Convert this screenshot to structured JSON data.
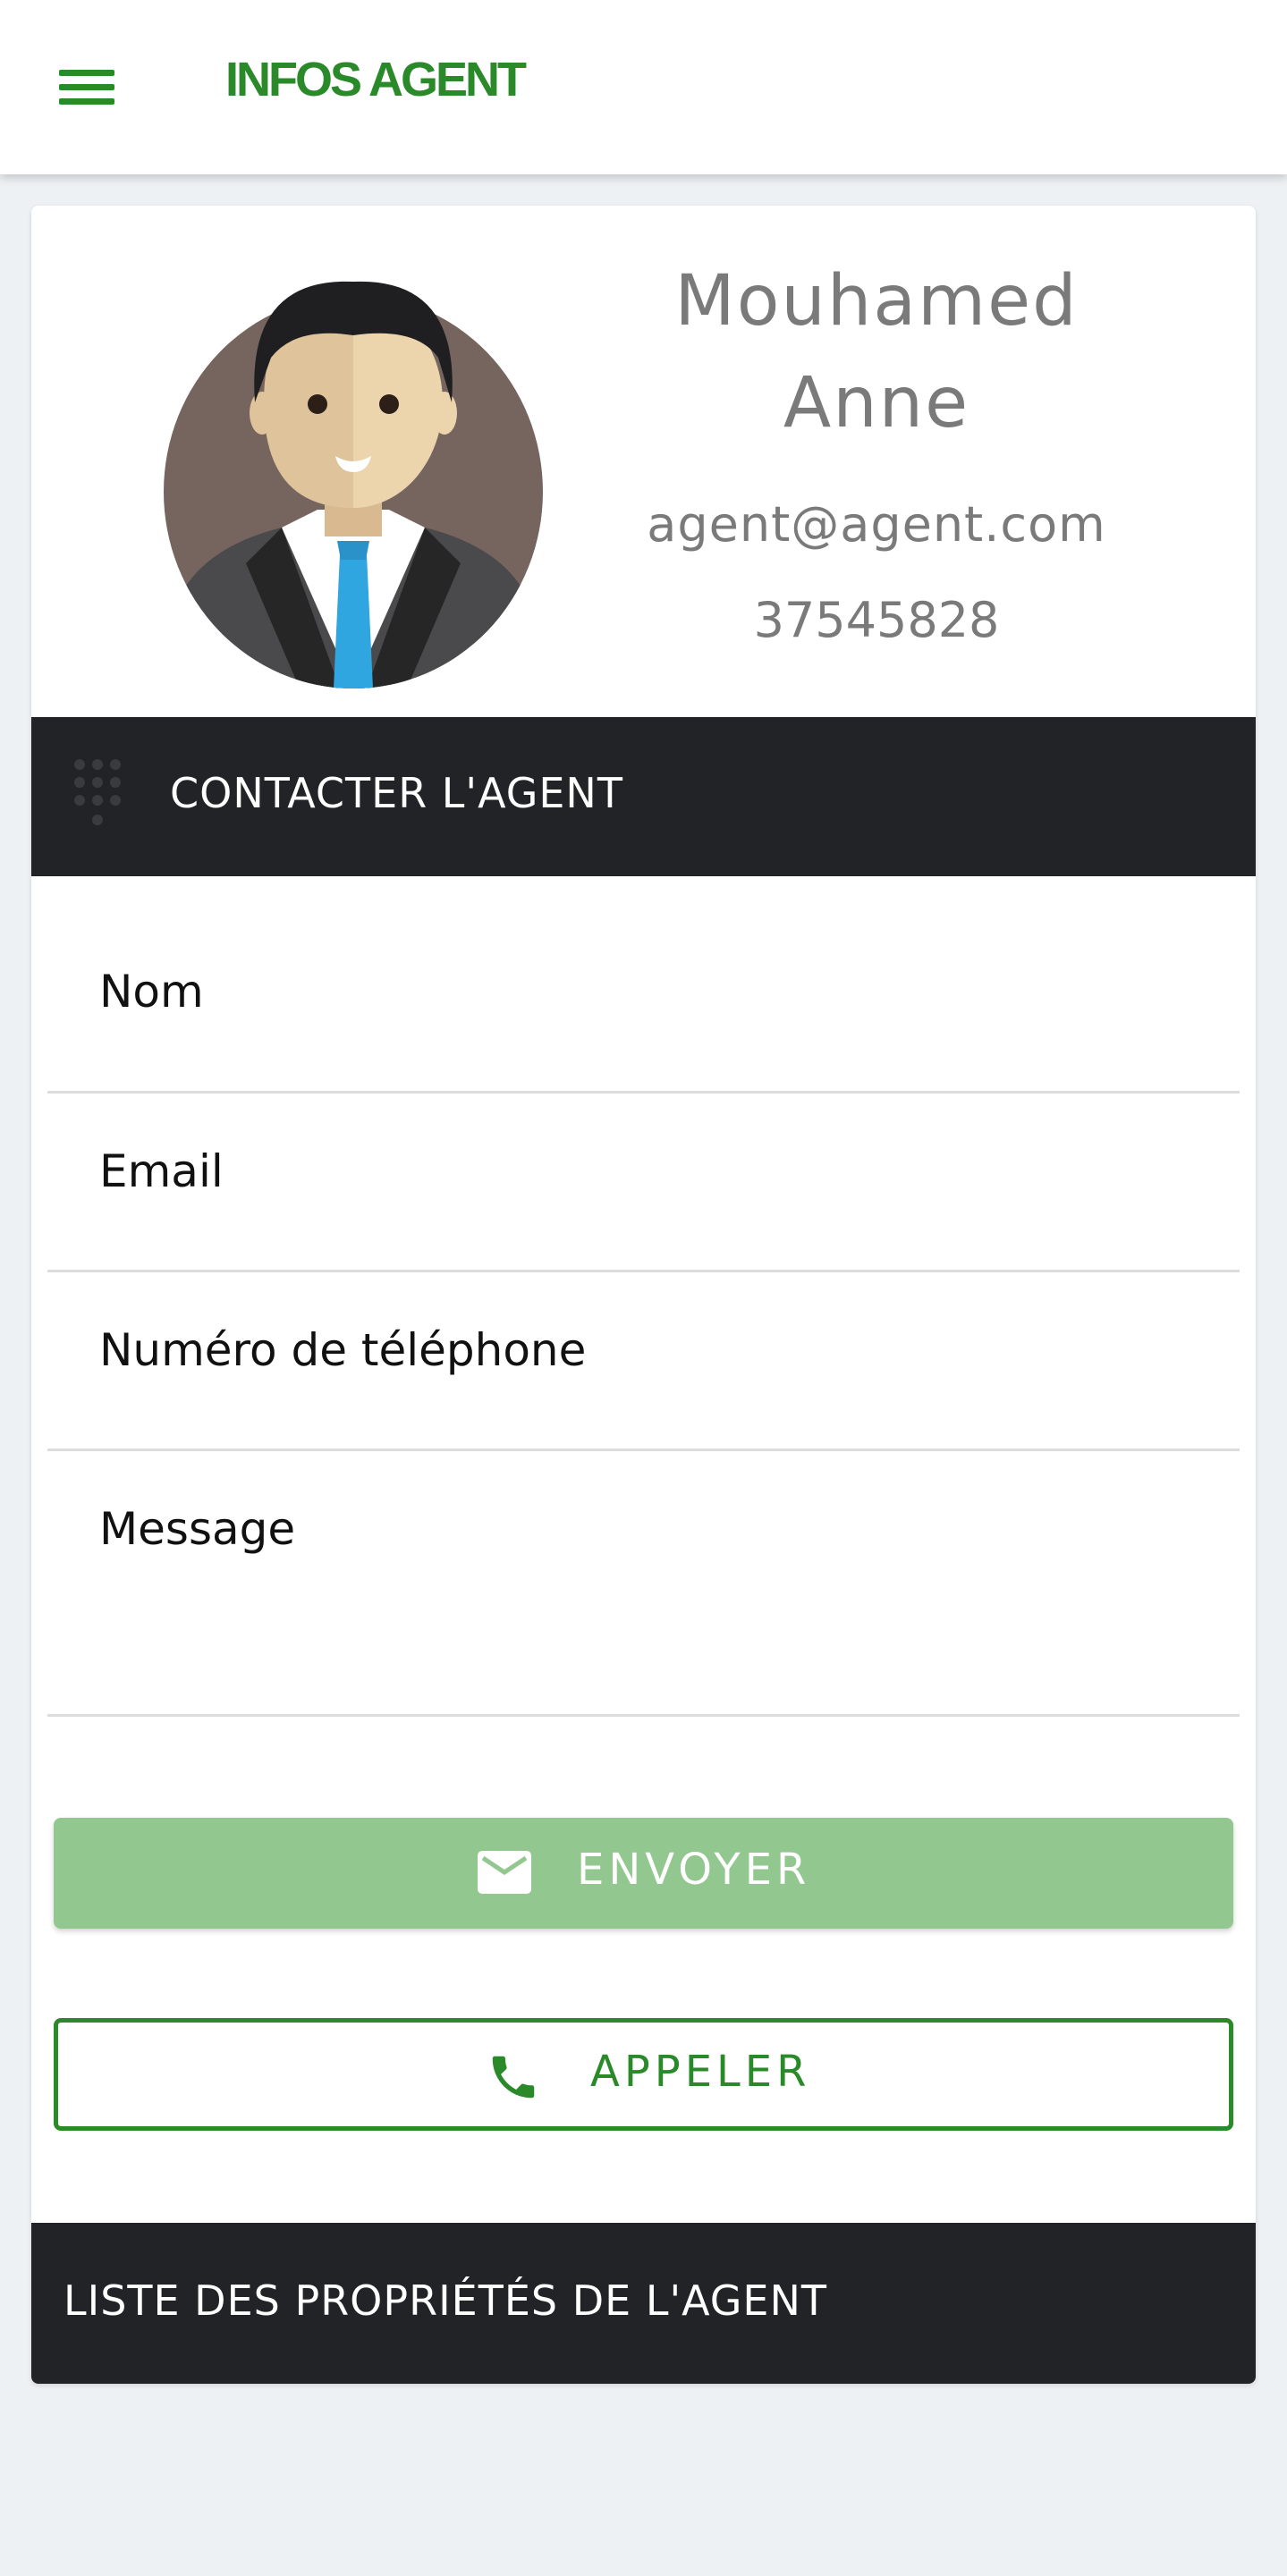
{
  "header": {
    "title": "INFOS AGENT",
    "menu_icon": "hamburger-menu-icon",
    "accent_color": "#2a8a2a"
  },
  "agent": {
    "first_name": "Mouhamed",
    "last_name": "Anne",
    "email": "agent@agent.com",
    "phone": "37545828",
    "avatar_icon": "businessman-avatar"
  },
  "contact_section": {
    "title": "CONTACTER L'AGENT",
    "icon": "dialpad-icon"
  },
  "form": {
    "name_placeholder": "Nom",
    "email_placeholder": "Email",
    "phone_placeholder": "Numéro de téléphone",
    "message_placeholder": "Message"
  },
  "buttons": {
    "send_label": "ENVOYER",
    "send_icon": "mail-icon",
    "send_color": "#93c790",
    "call_label": "APPELER",
    "call_icon": "phone-icon"
  },
  "properties_section": {
    "title": "LISTE DES PROPRIÉTÉS DE L'AGENT"
  }
}
